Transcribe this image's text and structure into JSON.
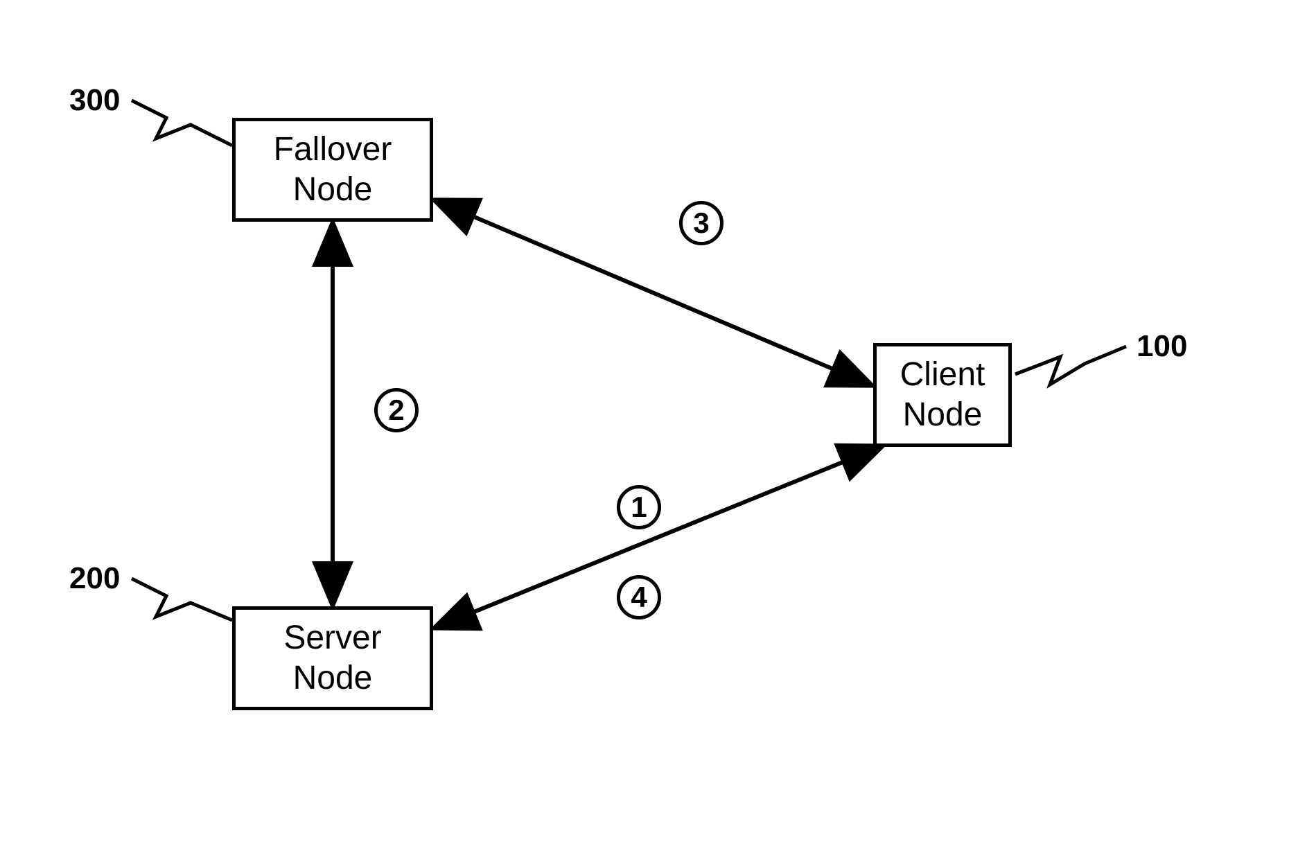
{
  "nodes": {
    "fallover": {
      "line1": "Fallover",
      "line2": "Node",
      "ref": "300"
    },
    "server": {
      "line1": "Server",
      "line2": "Node",
      "ref": "200"
    },
    "client": {
      "line1": "Client",
      "line2": "Node",
      "ref": "100"
    }
  },
  "edge_labels": {
    "one": "1",
    "two": "2",
    "three": "3",
    "four": "4"
  }
}
